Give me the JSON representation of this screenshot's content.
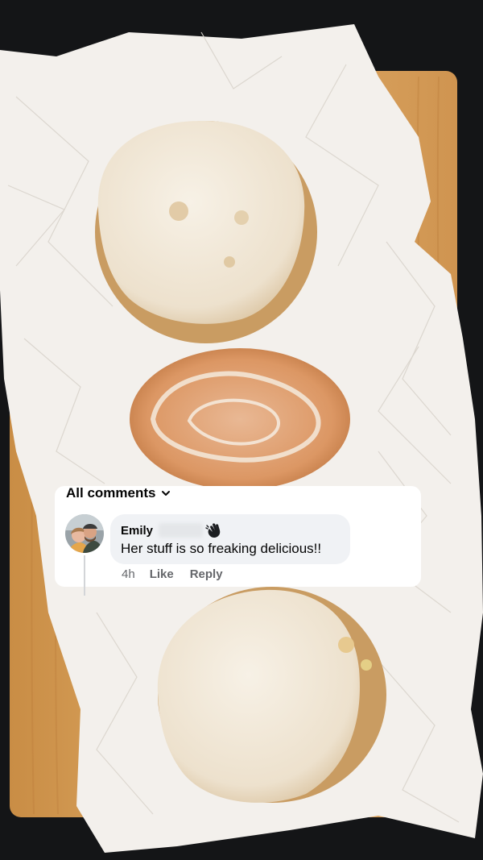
{
  "comments_panel": {
    "header_label": "All comments",
    "comment": {
      "author": "Emily",
      "text": "Her stuff is so freaking delicious!!",
      "time": "4h",
      "like_label": "Like",
      "reply_label": "Reply"
    }
  },
  "icons": {
    "sort_dropdown": "chevron-down-icon",
    "badge": "waving-hand-icon",
    "avatar": "profile-photo"
  },
  "colors": {
    "card_background": "#ffffff",
    "bubble_background": "#f0f2f5",
    "primary_text": "#050505",
    "secondary_text": "#65676b",
    "page_background": "#141517",
    "cutting_board": "#d9a35e",
    "parchment": "#f3f0ec",
    "glaze": "#f1e8da"
  }
}
